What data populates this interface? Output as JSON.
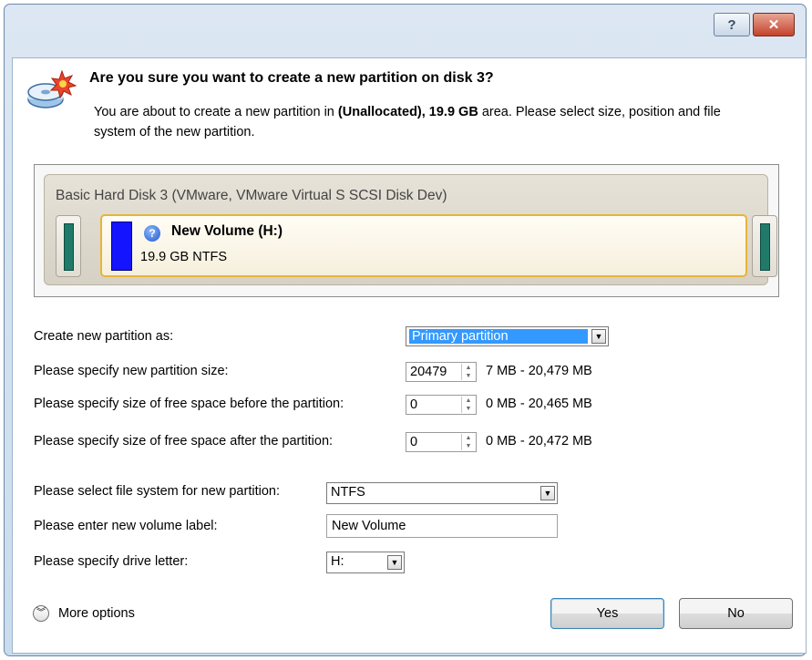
{
  "window": {
    "help_label": "?",
    "close_label": "✕"
  },
  "header": {
    "icon": "disk-add-icon",
    "question": "Are you sure you want to create a new partition on disk 3?",
    "desc_pre": "You are about to create a new partition in ",
    "desc_area": "(Unallocated), 19.9 GB",
    "desc_post": " area. Please select size, position and file system of the new partition."
  },
  "disk": {
    "title": "Basic Hard Disk 3 (VMware, VMware Virtual S SCSI Disk Dev)",
    "volume_name": "New Volume (H:)",
    "volume_info": "19.9 GB NTFS",
    "volume_icon": "help-circle-icon",
    "volume_color": "#1414ff"
  },
  "form": {
    "partition_type_label": "Create new partition as:",
    "partition_type_value": "Primary partition",
    "size_label": "Please specify new partition size:",
    "size_value": "20479",
    "size_range": "7 MB - 20,479 MB",
    "before_label": "Please specify size of free space before the partition:",
    "before_value": "0",
    "before_range": "0 MB - 20,465 MB",
    "after_label": "Please specify size of free space after the partition:",
    "after_value": "0",
    "after_range": "0 MB - 20,472 MB",
    "fs_label": "Please select file system for new partition:",
    "fs_value": "NTFS",
    "vol_label_label": "Please enter new volume label:",
    "vol_label_value": "New Volume",
    "drive_letter_label": "Please specify drive letter:",
    "drive_letter_value": "H:"
  },
  "footer": {
    "more_options": "More options",
    "yes": "Yes",
    "no": "No"
  }
}
